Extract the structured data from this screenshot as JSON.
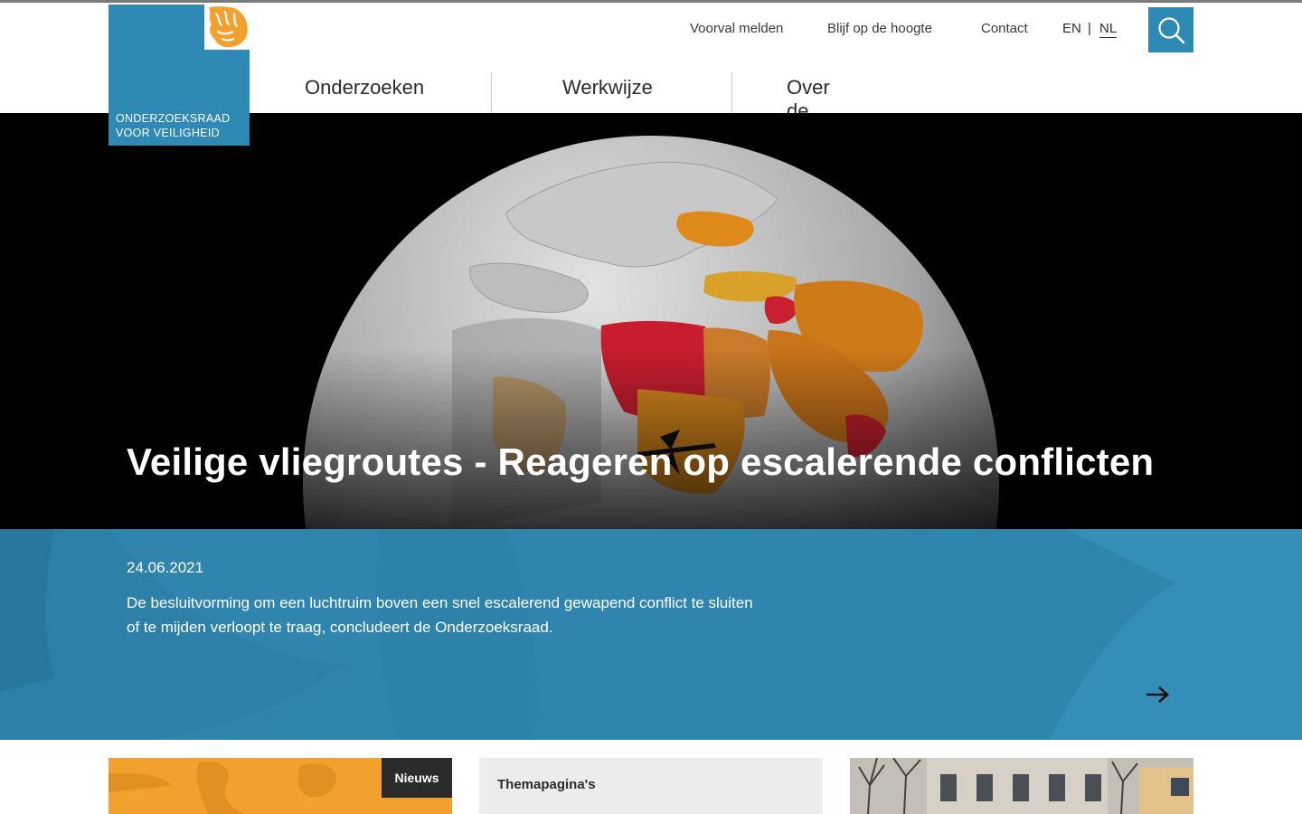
{
  "brand": {
    "logo_line1": "ONDERZOEKSRAAD",
    "logo_line2": "VOOR VEILIGHEID",
    "primary_color": "#2e8ab4",
    "accent_color": "#f2a12e"
  },
  "utility_nav": {
    "items": [
      "Voorval melden",
      "Blijf op de hoogte",
      "Contact"
    ],
    "lang_en": "EN",
    "lang_separator": "|",
    "lang_nl": "NL",
    "active_lang": "NL"
  },
  "main_nav": {
    "items": [
      "Onderzoeken",
      "Werkwijze",
      "Over de Raad"
    ]
  },
  "hero": {
    "title": "Veilige vliegroutes - Reageren op escalerende conflicten"
  },
  "teaser": {
    "date": "24.06.2021",
    "text": "De besluitvorming om een luchtruim boven een snel escalerend gewapend conflict te sluiten of te mijden verloopt te traag, concludeert de Onderzoeksraad."
  },
  "cards": {
    "news_tag": "Nieuws",
    "theme_label": "Themapagina's"
  },
  "icons": {
    "search": "search-icon",
    "arrow": "arrow-right-icon",
    "lion": "lion-logo-icon"
  }
}
